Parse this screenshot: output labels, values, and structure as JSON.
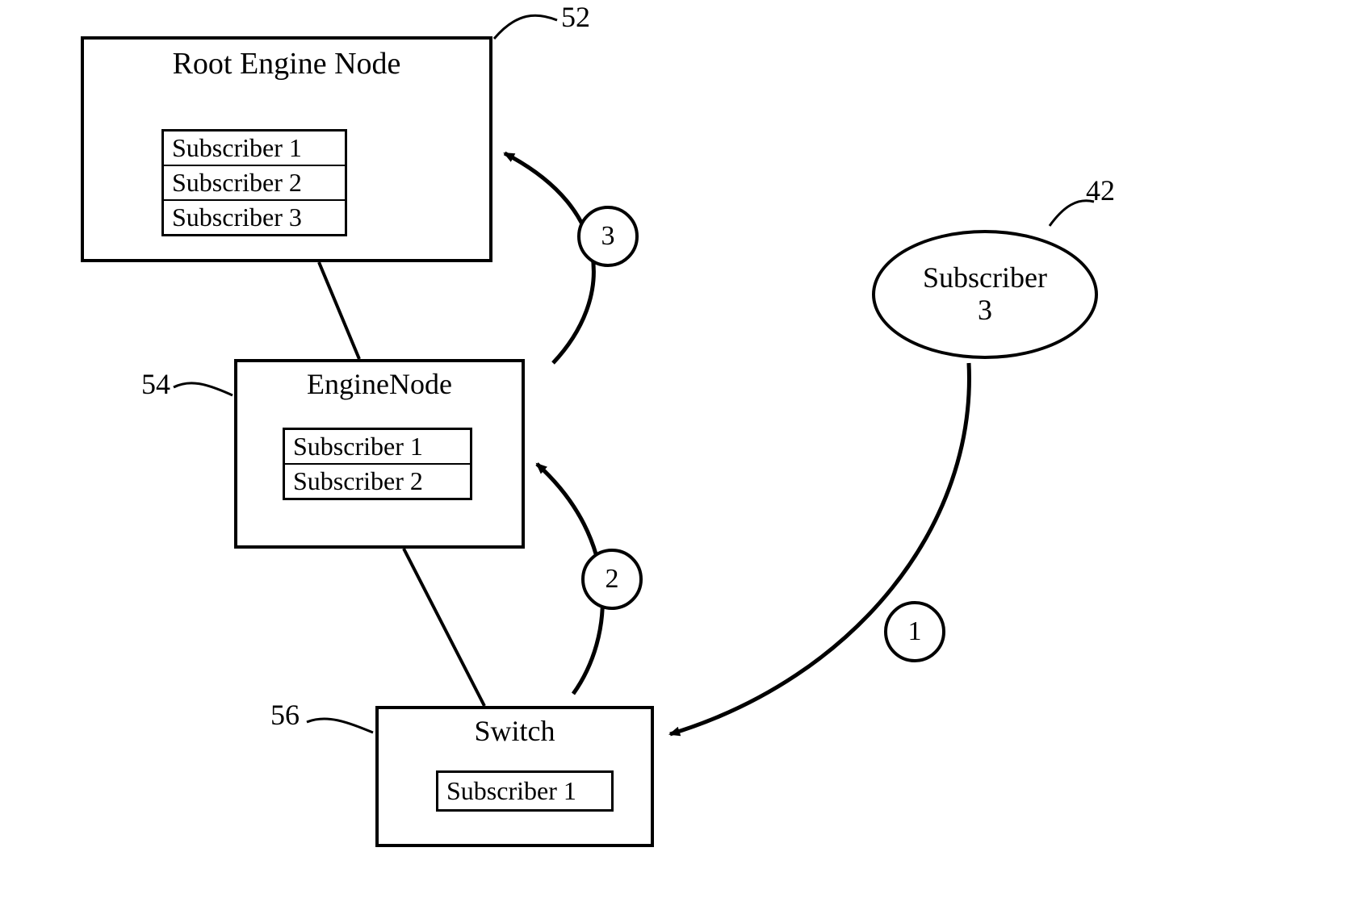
{
  "nodes": {
    "root": {
      "title": "Root Engine Node",
      "subs": [
        "Subscriber 1",
        "Subscriber 2",
        "Subscriber 3"
      ],
      "ref": "52"
    },
    "engine": {
      "title": "EngineNode",
      "subs": [
        "Subscriber 1",
        "Subscriber 2"
      ],
      "ref": "54"
    },
    "switch": {
      "title": "Switch",
      "subs": [
        "Subscriber 1"
      ],
      "ref": "56"
    }
  },
  "subscriber_ellipse": {
    "line1": "Subscriber",
    "line2": "3",
    "ref": "42"
  },
  "steps": {
    "s1": "1",
    "s2": "2",
    "s3": "3"
  }
}
